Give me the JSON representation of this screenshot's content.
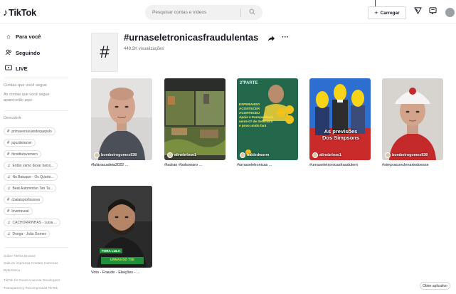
{
  "app": {
    "logo_glyph": "♪",
    "logo_text": "TikTok"
  },
  "header": {
    "search_placeholder": "Pesquisar contas e vídeos",
    "search_icon": "search-icon",
    "upload_label": "Carregar",
    "icons": [
      "send-icon",
      "inbox-icon",
      "profile-avatar"
    ]
  },
  "sidebar": {
    "nav": [
      {
        "label": "Para você",
        "icon": "home-icon"
      },
      {
        "label": "Seguindo",
        "icon": "following-icon"
      },
      {
        "label": "LIVE",
        "icon": "live-icon"
      }
    ],
    "following_text": "Contas que você segue",
    "following_hint": "As contas que você segue aparecerão aqui",
    "discover_title": "Descobrir",
    "discover": [
      {
        "label": "primaverasuandoquepulo",
        "icon": "hashtag"
      },
      {
        "label": "jujuzdetezrer",
        "icon": "hashtag"
      },
      {
        "label": "hinstitutsvemero",
        "icon": "hashtag"
      },
      {
        "label": "Então vamo dexar baixo...",
        "icon": "music"
      },
      {
        "label": "No Batuque - Os Quarte...",
        "icon": "music"
      },
      {
        "label": "Beat Automotivo Tan Ta...",
        "icon": "music"
      },
      {
        "label": "cbalaisprofissores",
        "icon": "hashtag"
      },
      {
        "label": "lovetraveal",
        "icon": "hashtag"
      },
      {
        "label": "CACHORRINHAS - Luisa ...",
        "icon": "music"
      },
      {
        "label": "Donga - João Gomes",
        "icon": "music"
      }
    ],
    "footer_1": "Sobre  TikTok Browse",
    "footer_2": "Sala de imprensa  Contato  Carreiras",
    "footer_3": "ByteDance",
    "footer_4": "TikTok for Good  Anunciar  Developers",
    "footer_5": "Transparency  Recompensas TikTok"
  },
  "tag": {
    "glyph": "#",
    "title": "#urnaseletronicasfraudulentas",
    "views": "449.2K visualizações",
    "share_icon": "share-icon",
    "more_icon": "more-icon"
  },
  "videos": [
    {
      "author": "bombeirogomes938",
      "caption": "#lulanacadeia2022 ..."
    },
    {
      "author": "alinebrlose1",
      "caption": "#ladrao #bolsonaro ..."
    },
    {
      "author": "baldedworm",
      "caption": "#urnaseletronicas ..."
    },
    {
      "author": "alinebrlose1",
      "caption": "#urnaseletronicasfraudulent"
    },
    {
      "author": "bombeirogomes938",
      "caption": "#simpraconclenartodoesse"
    },
    {
      "author": "",
      "caption": "Voto - Fraude - Eleições - ..."
    }
  ],
  "thumb_text": {
    "v3_tag": "2ºPARTE",
    "v3_caption": "ESPERANDO\nACONTECER\nACONTECEU\nApoie a transparência\nsente 07 de Setembro\ne povo unido fará",
    "v4_caption": "As previsões\nDos Simpsons",
    "v6_banner": "FORA LULA",
    "v6_bottom": "URNAS DO TSE"
  },
  "get_app": "Obter aplicativo",
  "colors": {
    "brand_red": "#fe2c55",
    "text": "#161823",
    "muted": "#8a8b91"
  }
}
